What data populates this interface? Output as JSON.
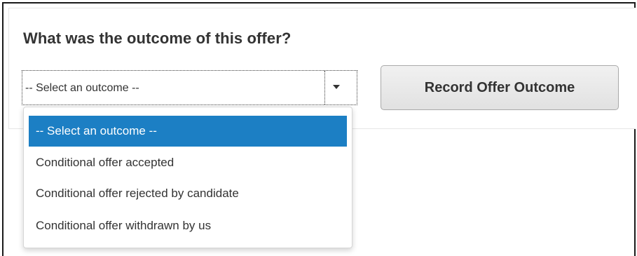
{
  "form": {
    "question": "What was the outcome of this offer?",
    "select_value": "-- Select an outcome --",
    "record_button_label": "Record Offer Outcome"
  },
  "dropdown": {
    "options": [
      {
        "label": "-- Select an outcome --",
        "selected": true
      },
      {
        "label": "Conditional offer accepted",
        "selected": false
      },
      {
        "label": "Conditional offer rejected by candidate",
        "selected": false
      },
      {
        "label": "Conditional offer withdrawn by us",
        "selected": false
      }
    ]
  },
  "colors": {
    "highlight": "#1c7fc4",
    "text": "#333333",
    "button_bg": "#e8e8e8"
  },
  "icons": {
    "select_arrow": "caret-down-icon"
  }
}
